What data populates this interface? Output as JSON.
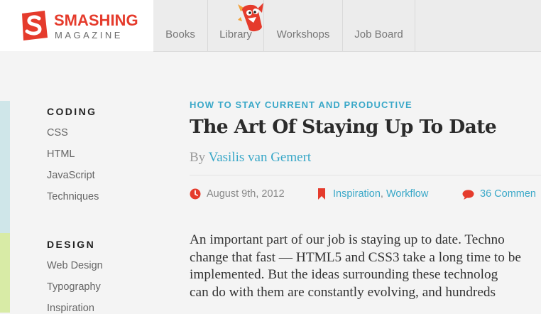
{
  "header": {
    "logo_word": "SMASHING",
    "logo_sub": "MAGAZINE",
    "nav": [
      "Books",
      "Library",
      "Workshops",
      "Job Board"
    ]
  },
  "sidebar": {
    "sections": [
      {
        "heading": "CODING",
        "links": [
          "CSS",
          "HTML",
          "JavaScript",
          "Techniques"
        ]
      },
      {
        "heading": "DESIGN",
        "links": [
          "Web Design",
          "Typography",
          "Inspiration"
        ]
      }
    ]
  },
  "article": {
    "kicker": "HOW TO STAY CURRENT AND PRODUCTIVE",
    "title": "The Art Of Staying Up To Date",
    "by": "By",
    "author": "Vasilis van Gemert",
    "date": "August 9th, 2012",
    "categories": [
      "Inspiration",
      "Workflow"
    ],
    "category_sep": ",",
    "comments": "36 Commen",
    "paragraph_lines": [
      "An important part of our job is staying up to date. Techno",
      "change that fast — HTML5 and CSS3 take a long time to be",
      "implemented. But the ideas surrounding these technolog",
      "can do with them are constantly evolving, and hundreds"
    ]
  },
  "colors": {
    "brand_red": "#e53b2c",
    "accent_blue": "#3aa8c8",
    "rail_blue": "#cfe6e9",
    "rail_green": "#d8eba6"
  },
  "icons": {
    "logo": "smashing-s-logo-icon",
    "mascot": "smashing-cat-mascot-icon",
    "date": "clock-icon",
    "category": "bookmark-icon",
    "comments": "speech-bubble-icon"
  }
}
